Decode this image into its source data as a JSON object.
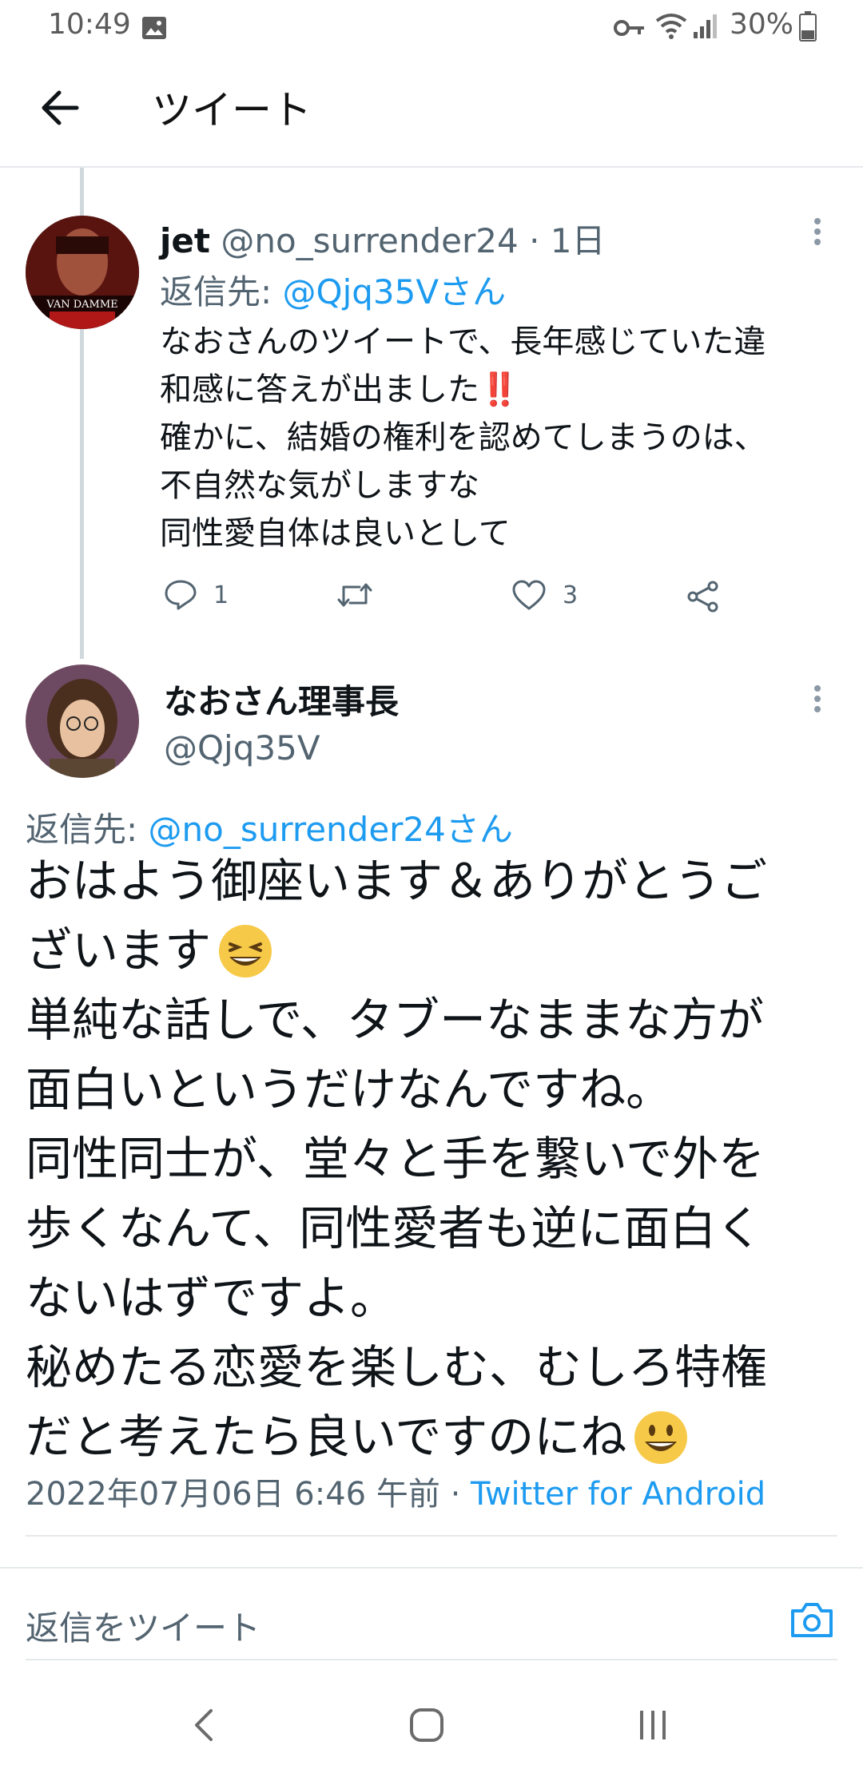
{
  "status_bar": {
    "time": "10:49",
    "battery": "30%",
    "icons": [
      "image-icon",
      "vpn-key-icon",
      "wifi-icon",
      "signal-icon",
      "battery-icon"
    ]
  },
  "header": {
    "title": "ツイート",
    "back_icon": "back-arrow-icon"
  },
  "tweet_parent": {
    "name": "jet",
    "handle": "@no_surrender24",
    "time": "· 1日",
    "reply_prefix": "返信先:",
    "reply_to": "@Qjq35Vさん",
    "avatar_text": "VAN DAMME",
    "lines": [
      "なおさんのツイートで、長年感じていた違",
      "和感に答えが出ました",
      "確かに、結婚の権利を認めてしまうのは、",
      "不自然な気がしますな",
      "同性愛自体は良いとして"
    ],
    "emoji": "‼️",
    "reply_count": "1",
    "retweet_count": "",
    "like_count": "3"
  },
  "tweet_main": {
    "name": "なおさん理事長",
    "handle": "@Qjq35V",
    "reply_prefix": "返信先:",
    "reply_to": "@no_surrender24さん",
    "lines": [
      "おはよう御座います＆ありがとうご",
      "ざいます",
      "単純な話しで、タブーなままな方が",
      "面白いというだけなんですね。",
      "同性同士が、堂々と手を繋いで外を",
      "歩くなんて、同性愛者も逆に面白く",
      "ないはずですよ。",
      "秘めたる恋愛を楽しむ、むしろ特権",
      "だと考えたら良いですのにね"
    ],
    "timestamp": "2022年07月06日 6:46 午前",
    "separator": "·",
    "source": "Twitter for Android"
  },
  "reply_bar": {
    "placeholder": "返信をツイート",
    "camera_icon": "camera-icon"
  },
  "colors": {
    "accent": "#1d9bf0",
    "text": "#0f1419",
    "muted": "#536471",
    "divider": "#e6e9ec",
    "thread_line": "#cfd9de",
    "emoji_red": "#e0245e",
    "emoji_yellow": "#f7c948"
  }
}
